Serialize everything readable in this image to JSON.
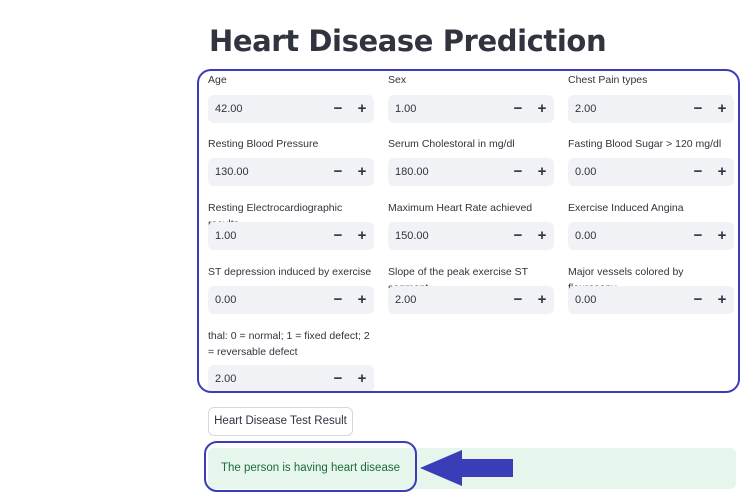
{
  "title": "Heart Disease Prediction",
  "fields": [
    {
      "label": "Age",
      "value": "42.00"
    },
    {
      "label": "Sex",
      "value": "1.00"
    },
    {
      "label": "Chest Pain types",
      "value": "2.00"
    },
    {
      "label": "Resting Blood Pressure",
      "value": "130.00"
    },
    {
      "label": "Serum Cholestoral in mg/dl",
      "value": "180.00"
    },
    {
      "label": "Fasting Blood Sugar > 120 mg/dl",
      "value": "0.00"
    },
    {
      "label": "Resting Electrocardiographic results",
      "value": "1.00"
    },
    {
      "label": "Maximum Heart Rate achieved",
      "value": "150.00"
    },
    {
      "label": "Exercise Induced Angina",
      "value": "0.00"
    },
    {
      "label": "ST depression induced by exercise",
      "value": "0.00"
    },
    {
      "label": "Slope of the peak exercise ST segment",
      "value": "2.00"
    },
    {
      "label": "Major vessels colored by flourosopy",
      "value": "0.00"
    },
    {
      "label": "thal: 0 = normal; 1 = fixed defect; 2 = reversable defect",
      "value": "2.00"
    }
  ],
  "stepper": {
    "minus": "−",
    "plus": "+"
  },
  "button_label": "Heart Disease Test Result",
  "result_text": "The person is having heart disease",
  "colors": {
    "annotation": "#3a3db8",
    "input_bg": "#f0f2f6",
    "success_bg": "#e6f6ec",
    "success_text": "#1c6b3b"
  }
}
